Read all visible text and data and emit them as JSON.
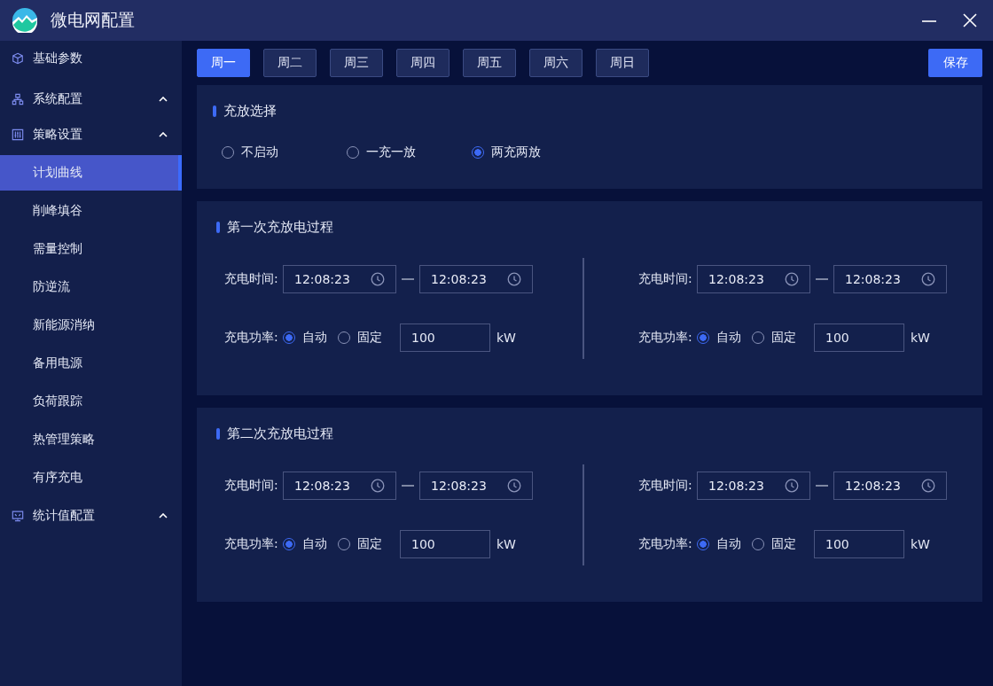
{
  "window": {
    "title": "微电网配置"
  },
  "sidebar": {
    "items": [
      {
        "label": "基础参数",
        "kind": "item",
        "selected": false
      },
      {
        "label": "系统配置",
        "kind": "group",
        "selected": false
      },
      {
        "label": "策略设置",
        "kind": "group",
        "selected": false,
        "children": [
          {
            "label": "计划曲线",
            "selected": true
          },
          {
            "label": "削峰填谷",
            "selected": false
          },
          {
            "label": "需量控制",
            "selected": false
          },
          {
            "label": "防逆流",
            "selected": false
          },
          {
            "label": "新能源消纳",
            "selected": false
          },
          {
            "label": "备用电源",
            "selected": false
          },
          {
            "label": "负荷跟踪",
            "selected": false
          },
          {
            "label": "热管理策略",
            "selected": false
          },
          {
            "label": "有序充电",
            "selected": false
          }
        ]
      },
      {
        "label": "统计值配置",
        "kind": "group",
        "selected": false
      }
    ]
  },
  "tabs": [
    {
      "label": "周一",
      "selected": true
    },
    {
      "label": "周二",
      "selected": false
    },
    {
      "label": "周三",
      "selected": false
    },
    {
      "label": "周四",
      "selected": false
    },
    {
      "label": "周五",
      "selected": false
    },
    {
      "label": "周六",
      "selected": false
    },
    {
      "label": "周日",
      "selected": false
    }
  ],
  "save_button": "保存",
  "charge_mode": {
    "title": "充放选择",
    "options": [
      {
        "label": "不启动",
        "selected": false
      },
      {
        "label": "一充一放",
        "selected": false
      },
      {
        "label": "两充两放",
        "selected": true
      }
    ]
  },
  "processes": [
    {
      "title": "第一次充放电过程",
      "segments": [
        {
          "time_label": "充电时间:",
          "start": "12:08:23",
          "end": "12:08:23",
          "power_label": "充电功率:",
          "options": [
            {
              "label": "自动",
              "selected": true
            },
            {
              "label": "固定",
              "selected": false
            }
          ],
          "value": "100",
          "unit": "kW"
        },
        {
          "time_label": "充电时间:",
          "start": "12:08:23",
          "end": "12:08:23",
          "power_label": "充电功率:",
          "options": [
            {
              "label": "自动",
              "selected": true
            },
            {
              "label": "固定",
              "selected": false
            }
          ],
          "value": "100",
          "unit": "kW"
        }
      ]
    },
    {
      "title": "第二次充放电过程",
      "segments": [
        {
          "time_label": "充电时间:",
          "start": "12:08:23",
          "end": "12:08:23",
          "power_label": "充电功率:",
          "options": [
            {
              "label": "自动",
              "selected": true
            },
            {
              "label": "固定",
              "selected": false
            }
          ],
          "value": "100",
          "unit": "kW"
        },
        {
          "time_label": "充电时间:",
          "start": "12:08:23",
          "end": "12:08:23",
          "power_label": "充电功率:",
          "options": [
            {
              "label": "自动",
              "selected": true
            },
            {
              "label": "固定",
              "selected": false
            }
          ],
          "value": "100",
          "unit": "kW"
        }
      ]
    }
  ]
}
